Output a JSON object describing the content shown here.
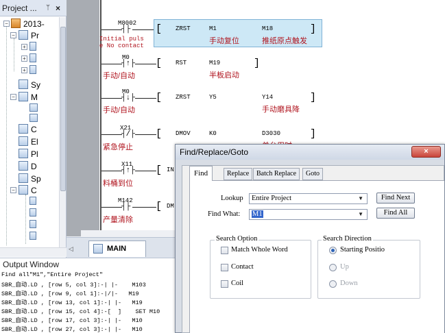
{
  "project_panel": {
    "title": "Project ...",
    "pin": "ᛘ",
    "close": "×",
    "root_label": "2013-",
    "items": [
      "Pr",
      "",
      "",
      "",
      "Sy",
      "M",
      "",
      "",
      "C",
      "El",
      "Pl",
      "D",
      "Sp",
      "C",
      "",
      "",
      "",
      ""
    ]
  },
  "ladder": {
    "rows": [
      {
        "contact": "M8002",
        "comment": "Initial puls\ne No contact",
        "instr": "ZRST",
        "op1": "M1",
        "op1_cmt": "手动复位",
        "op2": "M18",
        "op2_cmt": "推纸原点触发"
      },
      {
        "contact": "M0",
        "comment": "手动/自动",
        "instr": "RST",
        "op1": "M19",
        "op1_cmt": "半板启动",
        "op2": "",
        "op2_cmt": ""
      },
      {
        "contact": "M0",
        "comment": "手动/自动",
        "instr": "ZRST",
        "op1": "Y5",
        "op1_cmt": "",
        "op2": "Y14",
        "op2_cmt": "手动磨具降"
      },
      {
        "contact": "X21",
        "comment": "紧急停止",
        "instr": "DMOV",
        "op1": "K0",
        "op1_cmt": "",
        "op2": "D3030",
        "op2_cmt": "单台用时"
      },
      {
        "contact": "X11",
        "comment": "料桶到位",
        "instr": "IN",
        "op1": "",
        "op1_cmt": "",
        "op2": "",
        "op2_cmt": ""
      },
      {
        "contact": "M142",
        "comment": "产量清除",
        "instr": "DM",
        "op1": "",
        "op1_cmt": "",
        "op2": "",
        "op2_cmt": ""
      }
    ],
    "tab": "MAIN",
    "tab_nav": "◁"
  },
  "output": {
    "title": "Output Window",
    "lines": [
      "Find all\"M1\",\"Entire Project\"",
      "SBR_自动.LD , [row 5, col 3]:-| |-    M103",
      "SBR_自动.LD , [row 9, col 1]:-|/|-   M19",
      "SBR_自动.LD , [row 13, col 1]:-| |-   M19",
      "SBR_自动.LD , [row 15, col 4]:-[  ]    SET M10",
      "SBR_自动.LD , [row 17, col 3]:-| |-   M10",
      "SBR_自动.LD , [row 27, col 3]:-| |-   M10"
    ]
  },
  "dialog": {
    "title": "Find/Replace/Goto",
    "close": "×",
    "tabs": [
      "Find",
      "Replace",
      "Batch Replace",
      "Goto"
    ],
    "lookup_label": "Lookup",
    "lookup_value": "Entire Project",
    "find_what_label": "Find What:",
    "find_what_value": "M1",
    "find_next": "Find Next",
    "find_all": "Find All",
    "search_option_title": "Search Option",
    "options": [
      "Match Whole Word",
      "Contact",
      "Coil"
    ],
    "search_direction_title": "Search Direction",
    "directions": [
      "Starting Positio",
      "Up",
      "Down"
    ]
  },
  "colors": {
    "selection_fill": "#cde8f6",
    "comment_red": "#b0151f",
    "radio_selected": "#2d64b8"
  }
}
